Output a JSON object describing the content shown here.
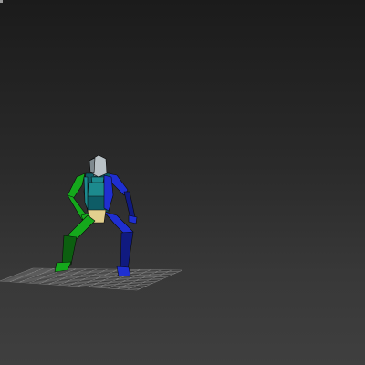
{
  "viewport": {
    "background_top": "#1b1b1b",
    "background_bottom": "#3f3f3f"
  },
  "scene": {
    "ground_grid": {
      "color": "#8a8a8a"
    },
    "biped": {
      "head_color": "#b9c2c6",
      "torso_color": "#0e5c66",
      "torso_highlight": "#1c8a8e",
      "pelvis_color": "#e2cf8e",
      "left_side_color": "#15a81c",
      "left_side_dark": "#0c5f10",
      "right_side_color": "#1f2fd0",
      "right_side_dark": "#101a80"
    }
  }
}
